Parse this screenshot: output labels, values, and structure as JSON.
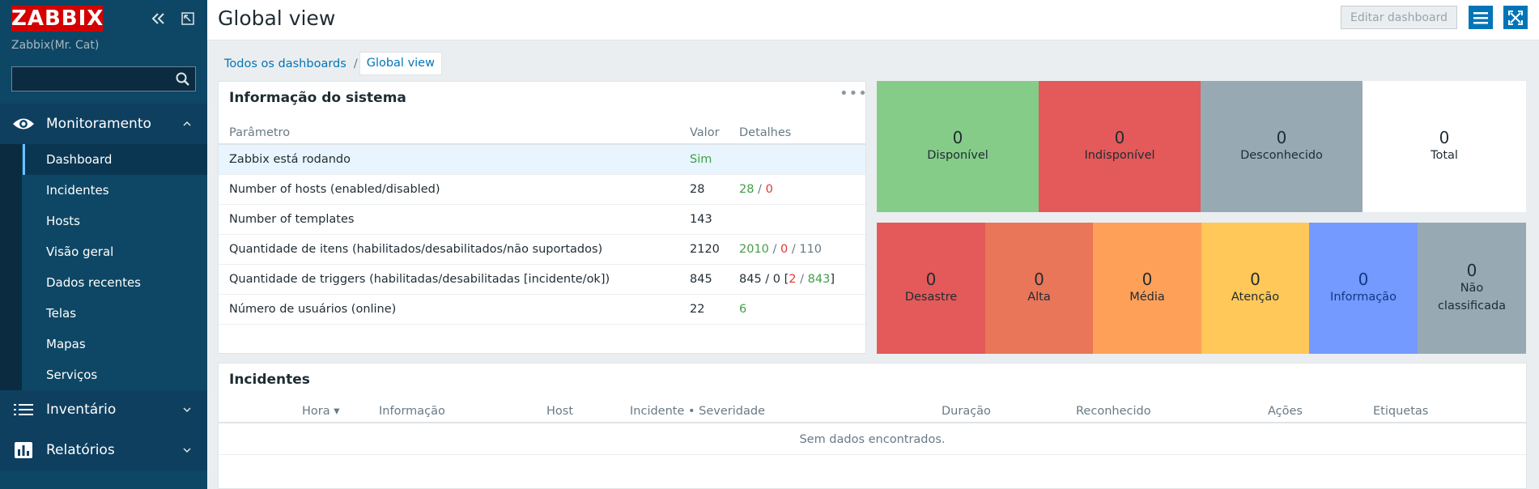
{
  "sidebar": {
    "logo": "ZABBIX",
    "server_name": "Zabbix(Mr. Cat)",
    "search_placeholder": "",
    "sections": {
      "monitoring": "Monitoramento",
      "inventory": "Inventário",
      "reports": "Relatórios"
    },
    "submenu": [
      "Dashboard",
      "Incidentes",
      "Hosts",
      "Visão geral",
      "Dados recentes",
      "Telas",
      "Mapas",
      "Serviços"
    ]
  },
  "header": {
    "title": "Global view",
    "edit_button": "Editar dashboard"
  },
  "breadcrumb": {
    "all": "Todos os dashboards",
    "separator": "/",
    "current": "Global view"
  },
  "system_info": {
    "title": "Informação do sistema",
    "columns": [
      "Parâmetro",
      "Valor",
      "Detalhes"
    ],
    "rows": [
      {
        "param": "Zabbix está rodando",
        "value": "Sim"
      },
      {
        "param": "Number of hosts (enabled/disabled)",
        "value": "28",
        "d1": "28",
        "s1": " / ",
        "d2": "0"
      },
      {
        "param": "Number of templates",
        "value": "143"
      },
      {
        "param": "Quantidade de itens (habilitados/desabilitados/não suportados)",
        "value": "2120",
        "d1": "2010",
        "s1": " / ",
        "d2": "0",
        "s2": " / ",
        "d3": "110"
      },
      {
        "param": "Quantidade de triggers (habilitadas/desabilitadas [incidente/ok])",
        "value": "845",
        "d0": "845 / 0 [",
        "d2": "2",
        "s2": " / ",
        "d1": "843",
        "d4": "]"
      },
      {
        "param": "Número de usuários (online)",
        "value": "22",
        "d1": "6"
      }
    ]
  },
  "host_availability": [
    {
      "count": "0",
      "label": "Disponível",
      "color": "#86cc89"
    },
    {
      "count": "0",
      "label": "Indisponível",
      "color": "#e45959"
    },
    {
      "count": "0",
      "label": "Desconhecido",
      "color": "#97aab3"
    },
    {
      "count": "0",
      "label": "Total",
      "color": "#ffffff"
    }
  ],
  "problems_by_severity": [
    {
      "count": "0",
      "label": "Desastre",
      "color": "#e45959"
    },
    {
      "count": "0",
      "label": "Alta",
      "color": "#e97659"
    },
    {
      "count": "0",
      "label": "Média",
      "color": "#ffa059"
    },
    {
      "count": "0",
      "label": "Atenção",
      "color": "#ffc859"
    },
    {
      "count": "0",
      "label": "Informação",
      "color": "#7499ff"
    },
    {
      "count": "0",
      "label": "Não classificada",
      "color": "#97aab3"
    }
  ],
  "incidents": {
    "title": "Incidentes",
    "columns": [
      "Hora ▾",
      "Informação",
      "Host",
      "Incidente • Severidade",
      "Duração",
      "Reconhecido",
      "Ações",
      "Etiquetas"
    ],
    "empty": "Sem dados encontrados."
  }
}
